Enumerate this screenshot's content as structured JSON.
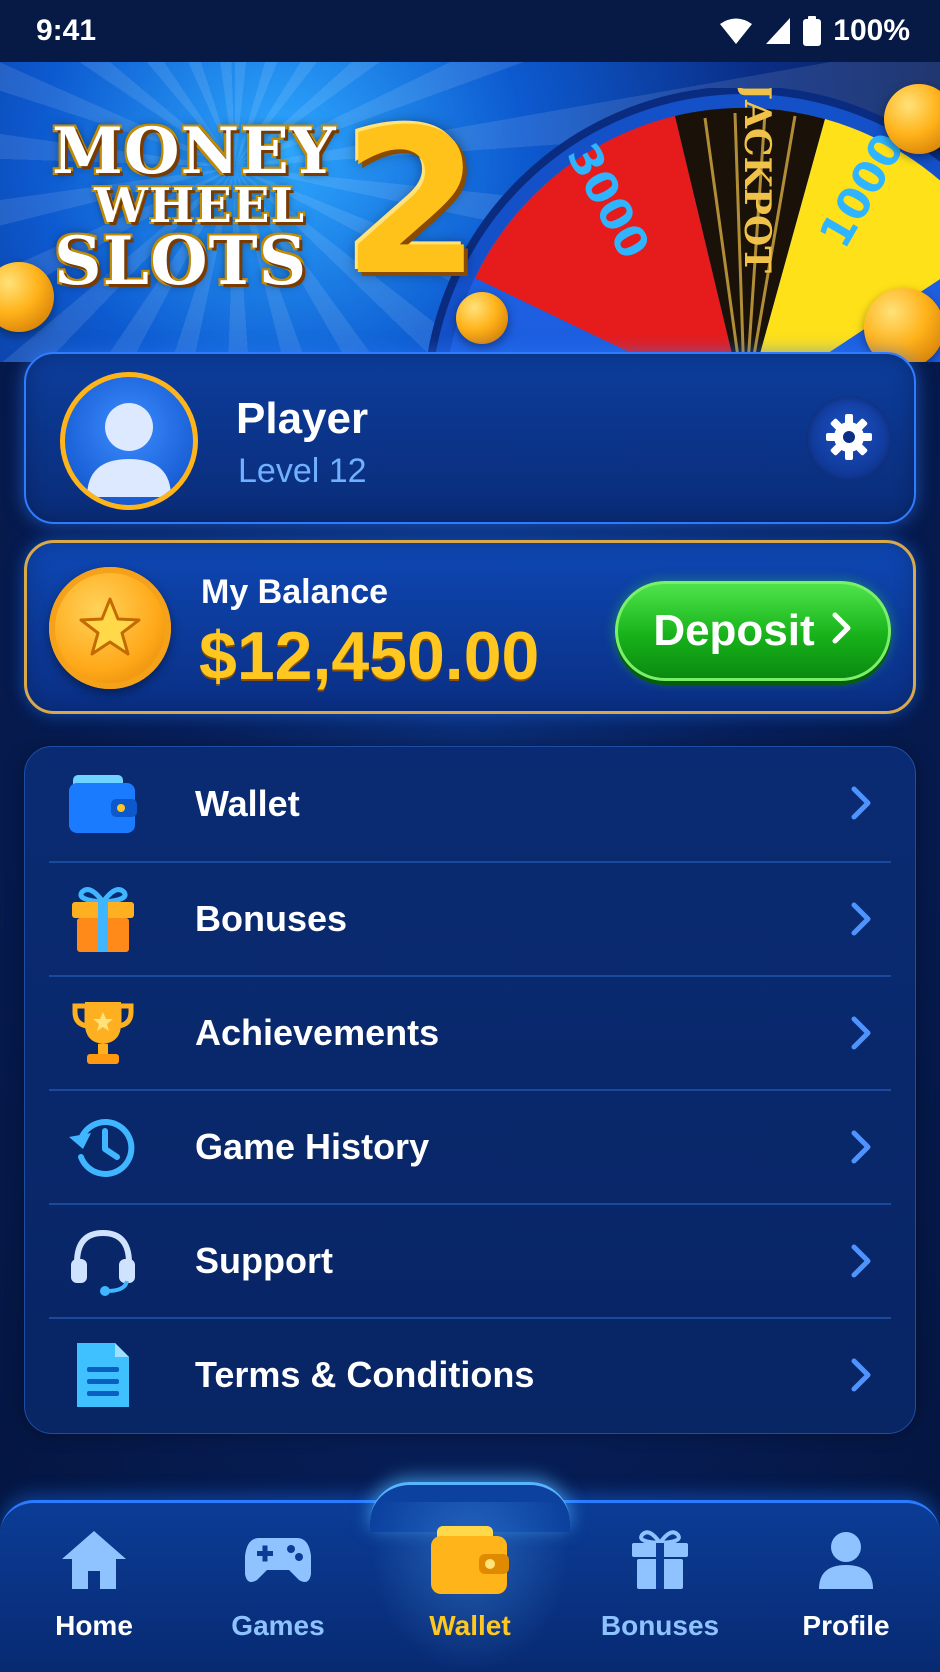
{
  "status_bar": {
    "time": "9:41",
    "battery": "100%"
  },
  "banner": {
    "logo_line1": "MONEY",
    "logo_line2": "WHEEL",
    "logo_line3": "SLOTS",
    "logo_number": "2",
    "wheel_segments": [
      "3000",
      "JACKPOT",
      "1000"
    ]
  },
  "profile": {
    "name": "Player",
    "level": "Level 12"
  },
  "balance": {
    "label": "My Balance",
    "amount": "$12,450.00",
    "deposit_label": "Deposit"
  },
  "menu": {
    "items": [
      {
        "label": "Wallet",
        "icon": "wallet-icon"
      },
      {
        "label": "Bonuses",
        "icon": "gift-icon"
      },
      {
        "label": "Achievements",
        "icon": "trophy-icon"
      },
      {
        "label": "Game History",
        "icon": "history-icon"
      },
      {
        "label": "Support",
        "icon": "headset-icon"
      },
      {
        "label": "Terms & Conditions",
        "icon": "document-icon"
      }
    ]
  },
  "nav": {
    "items": [
      {
        "label": "Home",
        "icon": "home-icon"
      },
      {
        "label": "Games",
        "icon": "gamepad-icon"
      },
      {
        "label": "Wallet",
        "icon": "wallet-icon",
        "active": true
      },
      {
        "label": "Bonuses",
        "icon": "gift-icon"
      },
      {
        "label": "Profile",
        "icon": "person-icon"
      }
    ]
  },
  "colors": {
    "accent_gold": "#ffc71f",
    "deposit_green": "#17b21a",
    "level_blue": "#6fb0ff",
    "nav_active": "#ffc71f",
    "nav_inactive": "#8fc3ff"
  }
}
